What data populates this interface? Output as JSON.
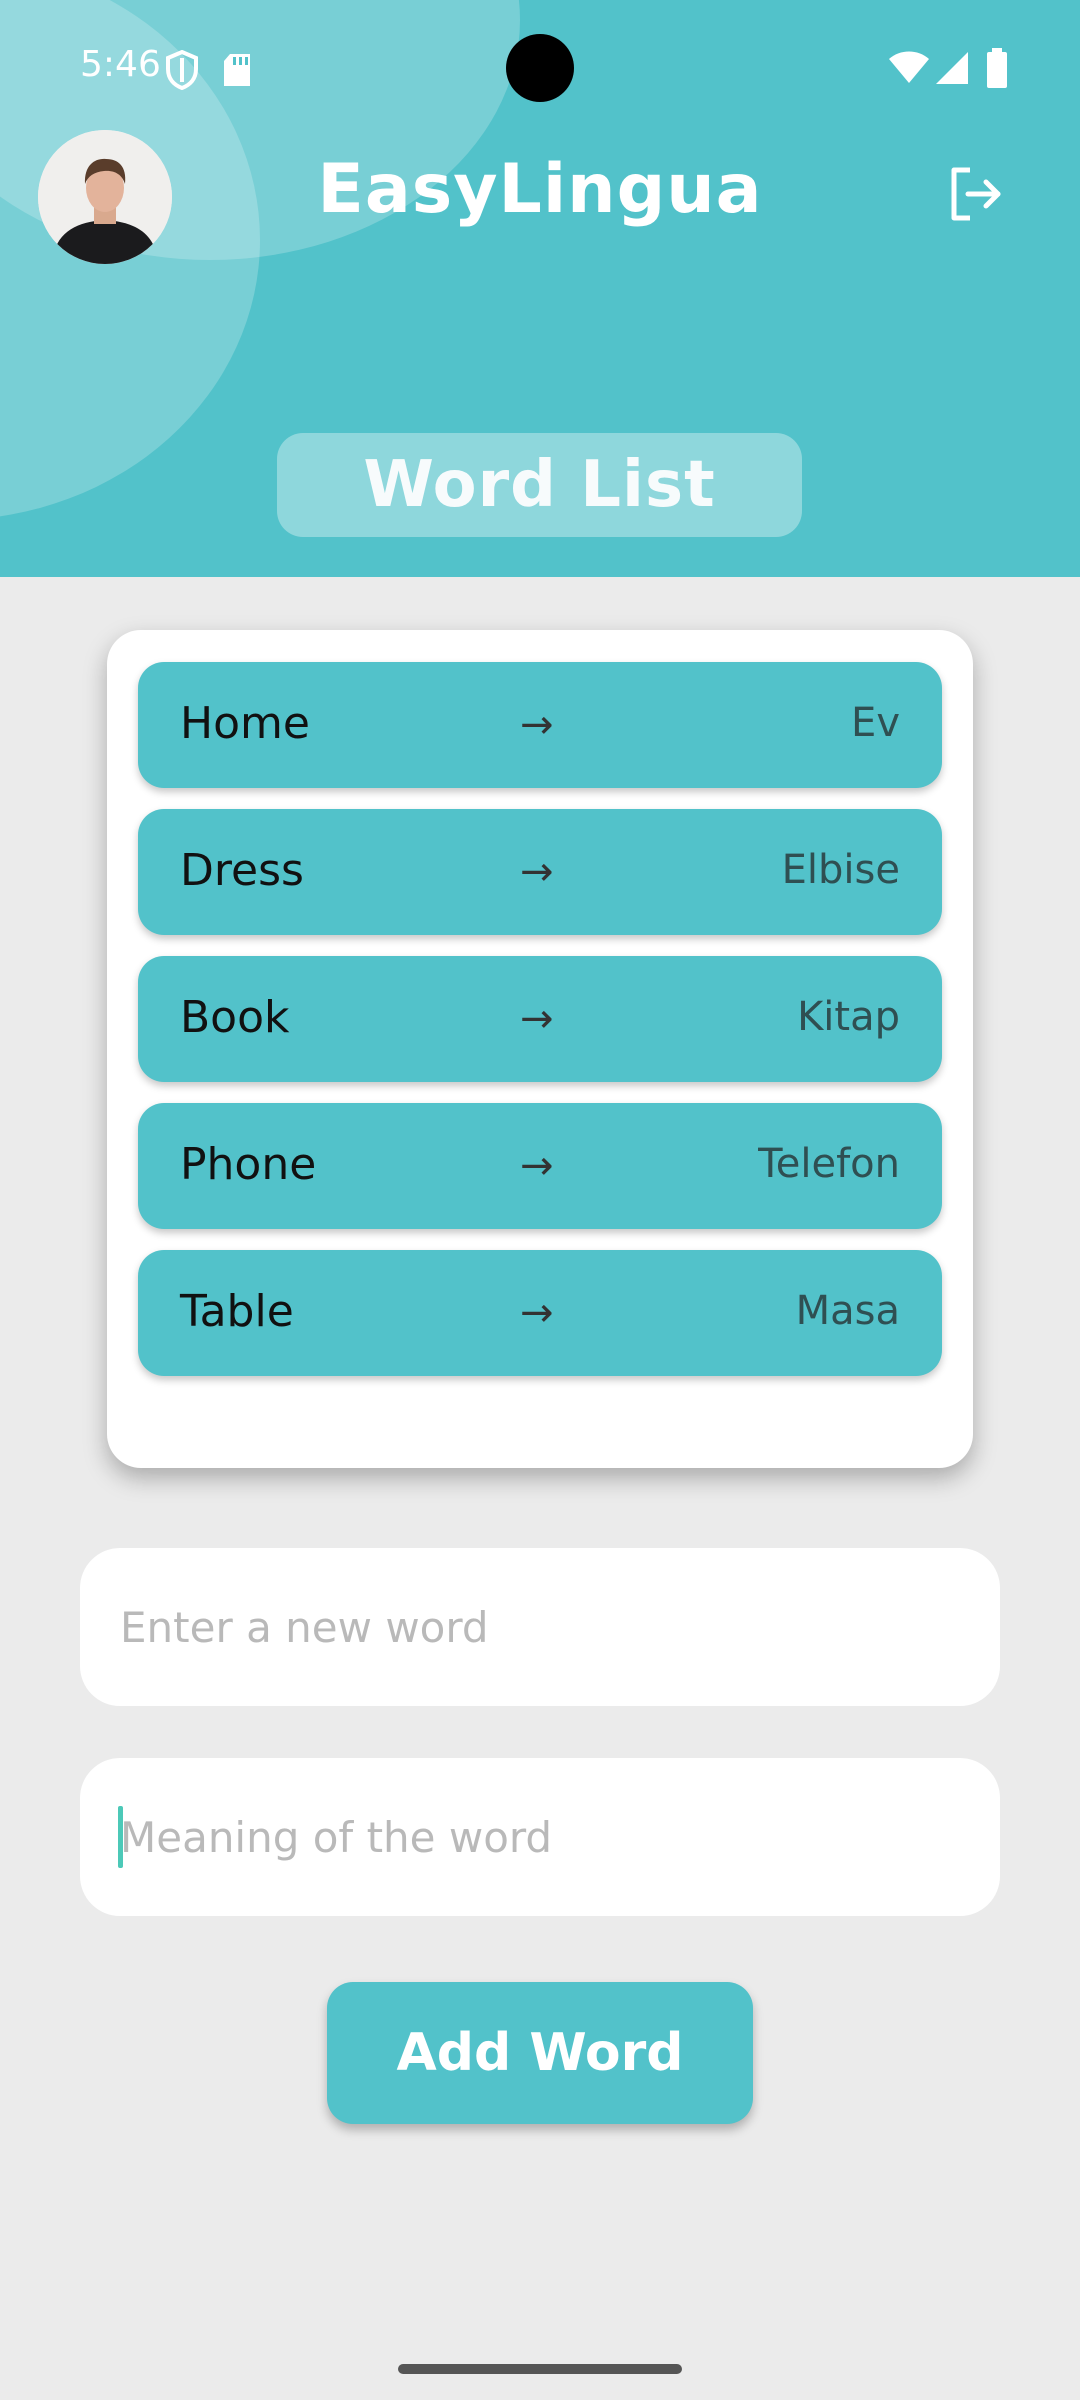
{
  "status_bar": {
    "time": "5:46",
    "icons": [
      "shield-icon",
      "sd-card-icon",
      "wifi-icon",
      "cell-signal-icon",
      "battery-icon"
    ]
  },
  "header": {
    "title": "EasyLingua",
    "section_label": "Word List",
    "background_color": "#52c2ca"
  },
  "words": [
    {
      "word": "Home",
      "arrow": "→",
      "meaning": "Ev"
    },
    {
      "word": "Dress",
      "arrow": "→",
      "meaning": "Elbise"
    },
    {
      "word": "Book",
      "arrow": "→",
      "meaning": "Kitap"
    },
    {
      "word": "Phone",
      "arrow": "→",
      "meaning": "Telefon"
    },
    {
      "word": "Table",
      "arrow": "→",
      "meaning": "Masa"
    }
  ],
  "form": {
    "word_placeholder": "Enter a new word",
    "word_value": "",
    "meaning_placeholder": "Meaning of the word",
    "meaning_value": "",
    "add_button_label": "Add Word"
  },
  "colors": {
    "accent": "#52c2ca",
    "background": "#ebebeb",
    "card": "#ffffff"
  }
}
